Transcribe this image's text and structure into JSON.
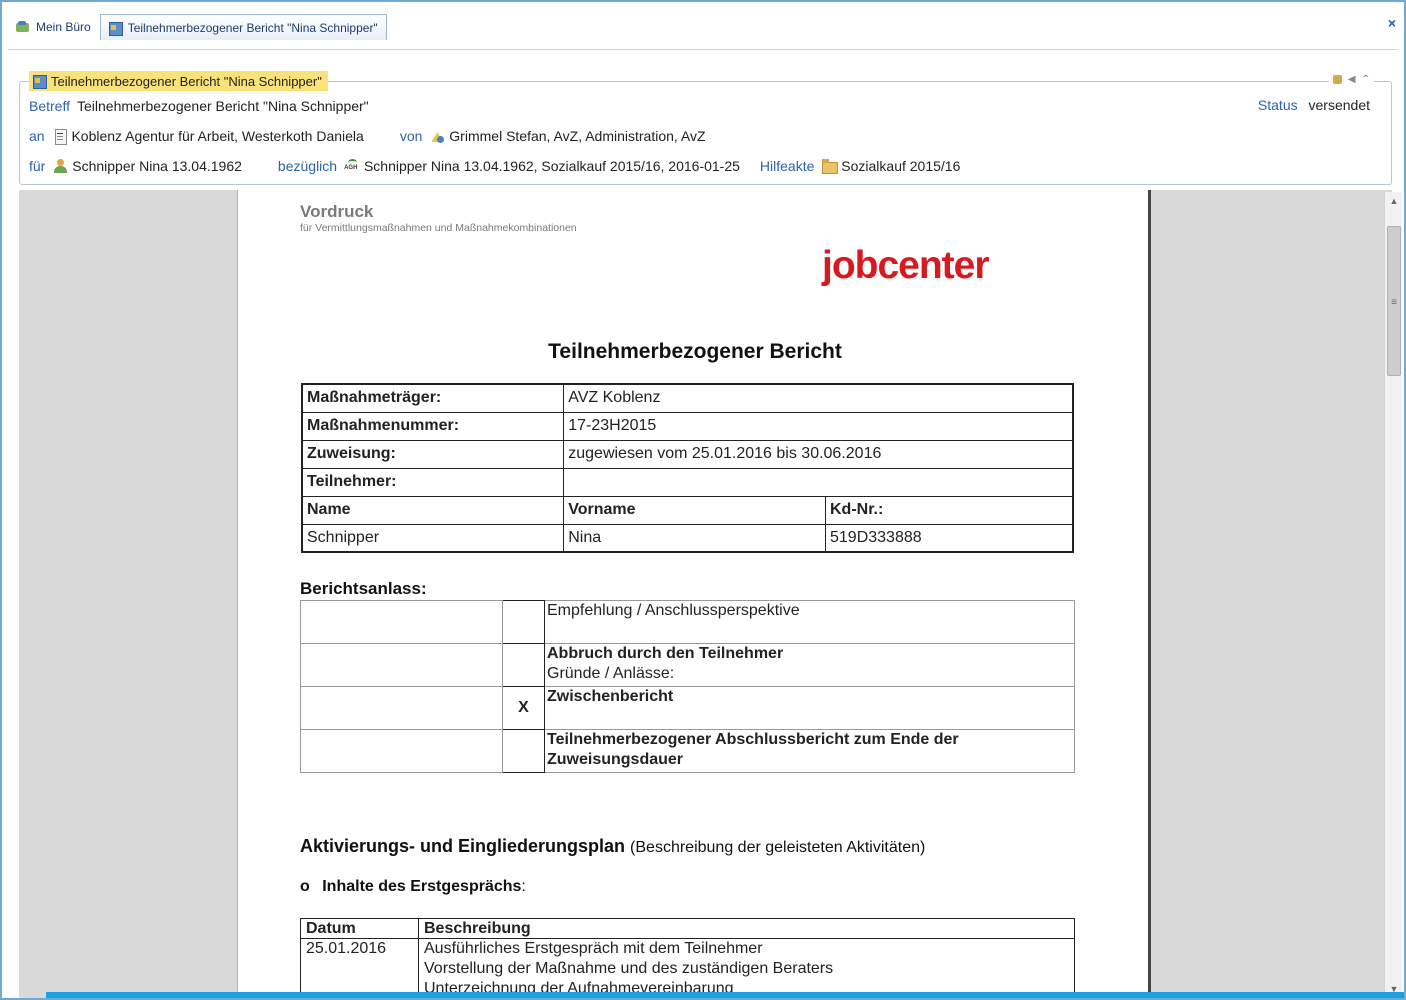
{
  "tabs": [
    {
      "label": "Mein Büro",
      "icon": "office-icon"
    },
    {
      "label": "Teilnehmerbezogener Bericht \"Nina Schnipper\"",
      "icon": "report-icon"
    }
  ],
  "close_label": "×",
  "panel": {
    "title": "Teilnehmerbezogener Bericht \"Nina Schnipper\"",
    "betreff_label": "Betreff",
    "betreff": "Teilnehmerbezogener Bericht \"Nina Schnipper\"",
    "status_label": "Status",
    "status": "versendet",
    "an_label": "an",
    "an": "Koblenz Agentur für Arbeit, Westerkoth Daniela",
    "von_label": "von",
    "von": "Grimmel Stefan, AvZ, Administration, AvZ",
    "fuer_label": "für",
    "fuer": "Schnipper Nina 13.04.1962",
    "bezueglich_label": "bezüglich",
    "bezueglich": "Schnipper Nina 13.04.1962, Sozialkauf 2015/16, 2016-01-25",
    "hilfeakte_label": "Hilfeakte",
    "hilfeakte": "Sozialkauf 2015/16"
  },
  "document": {
    "form_title": "Vordruck",
    "form_subtitle": "für Vermittlungsmaßnahmen und Maßnahmekombinationen",
    "logo": "jobcenter",
    "title": "Teilnehmerbezogener Bericht",
    "info": {
      "traeger_label": "Maßnahmeträger:",
      "traeger": "AVZ Koblenz",
      "nummer_label": "Maßnahmenummer:",
      "nummer": "17-23H2015",
      "zuweisung_label": "Zuweisung:",
      "zuweisung": "zugewiesen vom  25.01.2016 bis  30.06.2016",
      "teilnehmer_label": "Teilnehmer:",
      "col_name": "Name",
      "col_vorname": "Vorname",
      "col_kdnr": "Kd-Nr.:",
      "name": "Schnipper",
      "vorname": "Nina",
      "kdnr": "519D333888"
    },
    "berichtsanlass_label": "Berichtsanlass:",
    "reasons": [
      {
        "text": "Empfehlung / Anschlussperspektive",
        "sub": "",
        "mark": ""
      },
      {
        "text": "Abbruch durch den Teilnehmer",
        "sub": "Gründe / Anlässe:",
        "mark": ""
      },
      {
        "text": "Zwischenbericht",
        "sub": "",
        "mark": "X"
      },
      {
        "text": "Teilnehmerbezogener Abschlussbericht zum Ende der Zuweisungsdauer",
        "sub": "",
        "mark": ""
      }
    ],
    "plan_title": "Aktivierungs- und Eingliederungsplan",
    "plan_note": "(Beschreibung der geleisteten Aktivitäten)",
    "bullet_mark": "o",
    "bullet_text": "Inhalte des Erstgesprächs",
    "bullet_colon": ":",
    "notes": {
      "col_datum": "Datum",
      "col_beschreibung": "Beschreibung",
      "datum": "25.01.2016",
      "line1": "Ausführliches Erstgespräch mit dem Teilnehmer",
      "line2": "Vorstellung der Maßnahme und des zuständigen Beraters",
      "line3": "Unterzeichnung der Aufnahmevereinbarung"
    }
  },
  "colors": {
    "accent": "#1ba0e2",
    "label_blue": "#2e62a8",
    "highlight": "#f9e27a",
    "logo_red": "#d71920"
  }
}
